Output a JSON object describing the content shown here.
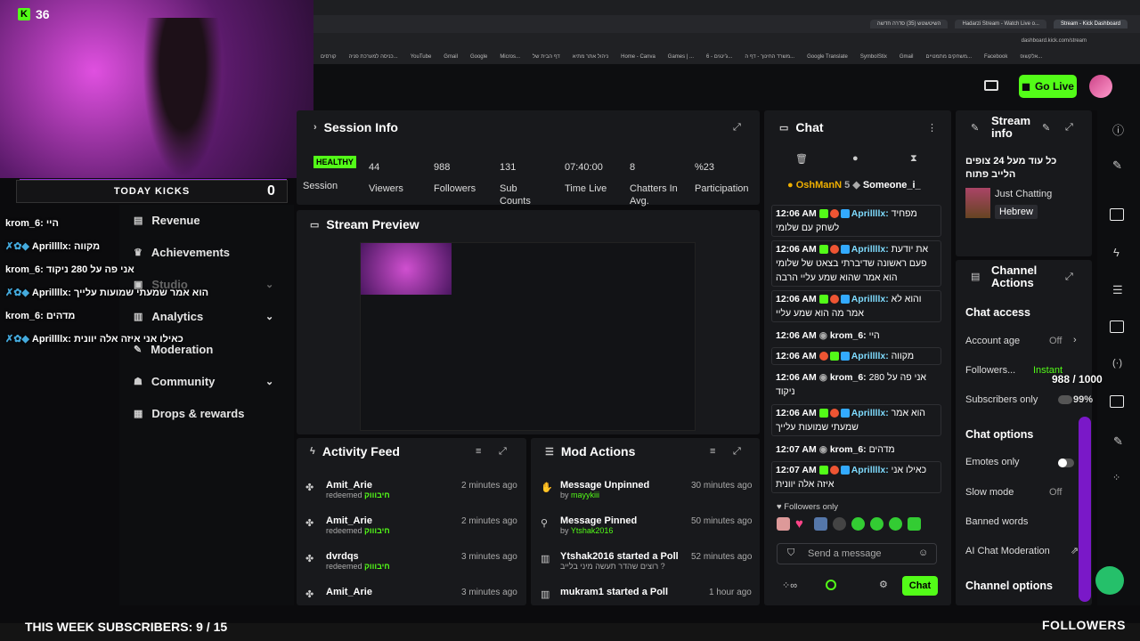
{
  "browser": {
    "tabs": [
      "השיטשטש (35) סדרה חדשה",
      "Hadarzi Stream - Watch Live o...",
      "Stream - Kick Dashboard"
    ],
    "address": "dashboard.kick.com/stream",
    "bookmarks": [
      "קורסים",
      "כניסה למערכת פניה...",
      "YouTube",
      "Gmail",
      "Google",
      "Micros...",
      "דף הבית של",
      "ניהול אתר מתיא",
      "Home - Canva",
      "Games | ...",
      "ג'ינגים - 6...",
      "משרד החינוך - דף ה...",
      "Google Translate",
      "SymbolStix",
      "Gmail",
      "משחקים מתמטיים...",
      "Facebook",
      "אלקשופ..."
    ]
  },
  "overlay": {
    "kick_count": "36",
    "today_kicks": "TODAY KICKS",
    "today_kicks_value": "0",
    "chat": [
      {
        "user": "krom_6:",
        "text": "היי"
      },
      {
        "user": "Aprillllx:",
        "text": "מקווה"
      },
      {
        "user": "krom_6:",
        "text": "אני פה על 280 ניקוד"
      },
      {
        "user": "Aprillllx:",
        "text": "הוא אמר שמעתי שמועות עלייך"
      },
      {
        "user": "krom_6:",
        "text": "מדהים"
      },
      {
        "user": "Aprillllx:",
        "text": "כאילו אני איזה אלה יוונית"
      }
    ],
    "week_subs": "THIS WEEK SUBSCRIBERS: 9 / 15",
    "followers_count": "988 / 1000",
    "followers_pct": "99%",
    "followers_label": "FOLLOWERS"
  },
  "header": {
    "go_live": "Go Live"
  },
  "sidebar": {
    "items": [
      {
        "label": "Revenue",
        "icon": "dollar-icon"
      },
      {
        "label": "Achievements",
        "icon": "trophy-icon"
      },
      {
        "label": "Studio",
        "icon": "studio-icon"
      },
      {
        "label": "Analytics",
        "icon": "chart-icon"
      },
      {
        "label": "Moderation",
        "icon": "wrench-icon"
      },
      {
        "label": "Community",
        "icon": "people-icon"
      },
      {
        "label": "Drops & rewards",
        "icon": "gift-icon"
      }
    ]
  },
  "session": {
    "title": "Session Info",
    "health": "HEALTHY",
    "health_label": "Session",
    "stats": [
      {
        "value": "44",
        "label": "Viewers"
      },
      {
        "value": "988",
        "label": "Followers"
      },
      {
        "value": "131",
        "label": "Sub Counts"
      },
      {
        "value": "07:40:00",
        "label": "Time Live"
      },
      {
        "value": "8",
        "label": "Chatters In Avg."
      },
      {
        "value": "%23",
        "label": "Participation"
      }
    ]
  },
  "preview": {
    "title": "Stream Preview"
  },
  "activity": {
    "title": "Activity Feed",
    "items": [
      {
        "user": "Amit_Arie",
        "action": "redeemed",
        "reward": "חיבוווק",
        "time": "2 minutes ago"
      },
      {
        "user": "Amit_Arie",
        "action": "redeemed",
        "reward": "חיבוווק",
        "time": "2 minutes ago"
      },
      {
        "user": "dvrdqs",
        "action": "redeemed",
        "reward": "חיבוווק",
        "time": "3 minutes ago"
      },
      {
        "user": "Amit_Arie",
        "action": "",
        "reward": "",
        "time": "3 minutes ago"
      }
    ]
  },
  "mod": {
    "title": "Mod Actions",
    "items": [
      {
        "title": "Message Unpinned",
        "by": "by",
        "user": "mayykiii",
        "time": "30 minutes ago"
      },
      {
        "title": "Message Pinned",
        "by": "by",
        "user": "Ytshak2016",
        "time": "50 minutes ago"
      },
      {
        "title": "Ytshak2016 started a Poll",
        "by": "",
        "user": "רוצים שהדר תעשה מיני בלייב ?",
        "time": "52 minutes ago"
      },
      {
        "title": "mukram1 started a Poll",
        "by": "",
        "user": "",
        "time": "1 hour ago"
      }
    ]
  },
  "chat": {
    "title": "Chat",
    "top_users": [
      {
        "name": "OshManN",
        "count": "5"
      },
      {
        "name": "Someone_i_"
      }
    ],
    "messages": [
      {
        "time": "12:06 AM",
        "user": "Aprillllx:",
        "text": "מפחיד לשחק עם שלומי"
      },
      {
        "time": "12:06 AM",
        "user": "Aprillllx:",
        "text": "את יודעת פעם ראשונה שדיברתי בצאט של שלומי הוא אמר שהוא שמע עליי הרבה"
      },
      {
        "time": "12:06 AM",
        "user": "Aprillllx:",
        "text": "והוא לא אמר מה הוא שמע עליי"
      },
      {
        "time": "12:06 AM",
        "user": "krom_6:",
        "text": "היי"
      },
      {
        "time": "12:06 AM",
        "user": "Aprillllx:",
        "text": "מקווה"
      },
      {
        "time": "12:06 AM",
        "user": "krom_6:",
        "text": "אני פה על 280 ניקוד"
      },
      {
        "time": "12:06 AM",
        "user": "Aprillllx:",
        "text": "הוא אמר שמעתי שמועות עלייך"
      },
      {
        "time": "12:07 AM",
        "user": "krom_6:",
        "text": "מדהים"
      },
      {
        "time": "12:07 AM",
        "user": "Aprillllx:",
        "text": "כאילו אני איזה אלה יוונית"
      }
    ],
    "followers_only": "Followers only",
    "placeholder": "Send a message",
    "send_label": "Chat"
  },
  "stream_info": {
    "title": "Stream info",
    "stream_title": "כל עוד מעל 24 צופים הלייב פתוח",
    "category": "Just Chatting",
    "language": "Hebrew"
  },
  "channel_actions": {
    "title": "Channel Actions",
    "chat_access": "Chat access",
    "account_age": "Account age",
    "account_age_val": "Off",
    "followers": "Followers...",
    "followers_val": "Instant",
    "subscribers_only": "Subscribers only",
    "chat_options": "Chat options",
    "emotes_only": "Emotes only",
    "slow_mode": "Slow mode",
    "slow_mode_val": "Off",
    "banned_words": "Banned words",
    "ai_moderation": "AI Chat Moderation",
    "channel_options": "Channel options"
  }
}
